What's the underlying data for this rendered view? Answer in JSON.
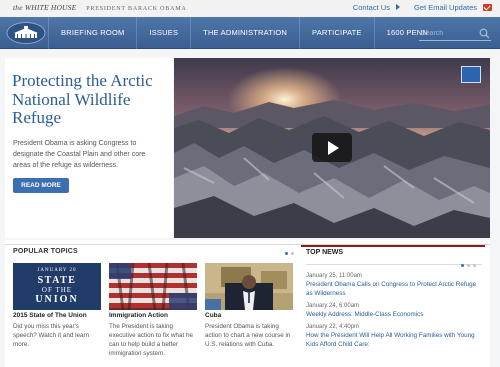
{
  "brand": {
    "title": "the WHITE HOUSE",
    "subtitle": "PRESIDENT BARACK OBAMA"
  },
  "top_links": {
    "contact": "Contact Us",
    "email": "Get Email Updates"
  },
  "nav": {
    "items": [
      "BRIEFING ROOM",
      "ISSUES",
      "THE ADMINISTRATION",
      "PARTICIPATE",
      "1600 PENN"
    ]
  },
  "search": {
    "placeholder": "Search"
  },
  "hero": {
    "title": "Protecting the Arctic National Wildlife Refuge",
    "description": "President Obama is asking Congress to designate the Coastal Plain and other core areas of the refuge as wilderness.",
    "button": "READ MORE"
  },
  "popular": {
    "heading": "POPULAR TOPICS",
    "cards": [
      {
        "title": "2015 State of The Union",
        "description": "Did you miss this year's speech? Watch it and learn more.",
        "image_date": "JANUARY 20",
        "image_line1": "STATE",
        "image_line2": "OF THE",
        "image_line3": "UNION"
      },
      {
        "title": "Immigration Action",
        "description": "The President is taking executive action to fix what he can to help build a better immigration system."
      },
      {
        "title": "Cuba",
        "description": "President Obama is taking action to chart a new course in U.S. relations with Cuba."
      }
    ]
  },
  "top_news": {
    "heading": "TOP NEWS",
    "items": [
      {
        "date": "January 25, 11:00am",
        "headline": "President Obama Calls on Congress to Protect Arctic Refuge as Wilderness"
      },
      {
        "date": "January 24, 6:00am",
        "headline": "Weekly Address: Middle-Class Economics"
      },
      {
        "date": "January 22, 4:40pm",
        "headline": "How the President Will Help All Working Families with Young Kids Afford Child Care:"
      }
    ]
  },
  "colors": {
    "nav_bg": "#3a5f92",
    "link_blue": "#2a6eb0",
    "headline_blue": "#2a5d96",
    "button_blue": "#3a6fb3",
    "top_news_red": "#8c1c1c"
  },
  "icons": [
    "white-house-logo",
    "search-icon",
    "email-icon",
    "play-icon",
    "slider-dot"
  ]
}
